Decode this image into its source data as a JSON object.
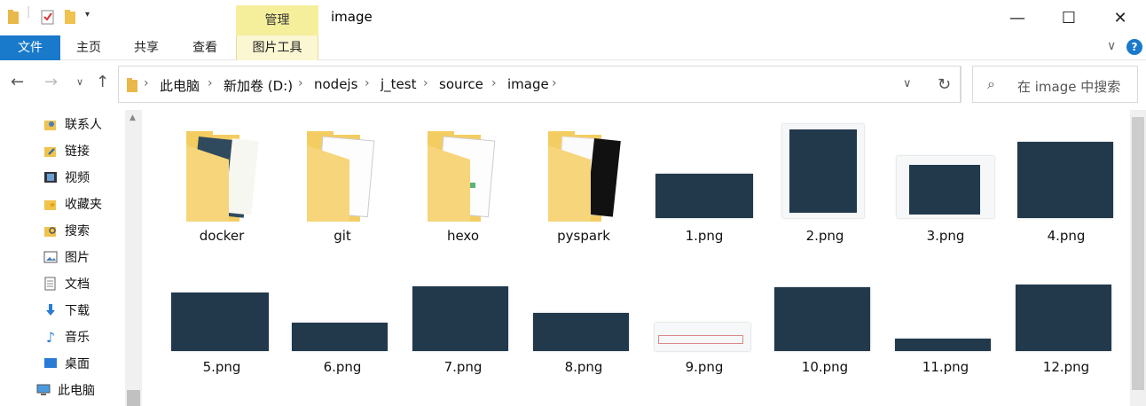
{
  "window": {
    "title": "image",
    "context_tab": "管理",
    "controls": {
      "minimize": "—",
      "maximize": "☐",
      "close": "✕"
    }
  },
  "ribbon": {
    "tabs": [
      {
        "label": "文件"
      },
      {
        "label": "主页"
      },
      {
        "label": "共享"
      },
      {
        "label": "查看"
      },
      {
        "label": "图片工具"
      }
    ],
    "help_icon": "?"
  },
  "address": {
    "root_icon": "folder-icon",
    "crumbs": [
      "此电脑",
      "新加卷 (D:)",
      "nodejs",
      "j_test",
      "source",
      "image"
    ]
  },
  "search": {
    "placeholder": "在 image 中搜索"
  },
  "sidebar": {
    "items": [
      {
        "label": "联系人",
        "icon": "contacts-icon"
      },
      {
        "label": "链接",
        "icon": "links-icon"
      },
      {
        "label": "视频",
        "icon": "videos-icon"
      },
      {
        "label": "收藏夹",
        "icon": "favorites-icon"
      },
      {
        "label": "搜索",
        "icon": "searches-icon"
      },
      {
        "label": "图片",
        "icon": "pictures-icon"
      },
      {
        "label": "文档",
        "icon": "documents-icon"
      },
      {
        "label": "下载",
        "icon": "downloads-icon"
      },
      {
        "label": "音乐",
        "icon": "music-icon"
      },
      {
        "label": "桌面",
        "icon": "desktop-icon"
      },
      {
        "label": "此电脑",
        "icon": "this-pc-icon"
      }
    ]
  },
  "files": [
    {
      "name": "docker",
      "kind": "folder"
    },
    {
      "name": "git",
      "kind": "folder"
    },
    {
      "name": "hexo",
      "kind": "folder"
    },
    {
      "name": "pyspark",
      "kind": "folder"
    },
    {
      "name": "1.png",
      "kind": "image"
    },
    {
      "name": "2.png",
      "kind": "image"
    },
    {
      "name": "3.png",
      "kind": "image"
    },
    {
      "name": "4.png",
      "kind": "image"
    },
    {
      "name": "5.png",
      "kind": "image"
    },
    {
      "name": "6.png",
      "kind": "image"
    },
    {
      "name": "7.png",
      "kind": "image"
    },
    {
      "name": "8.png",
      "kind": "image"
    },
    {
      "name": "9.png",
      "kind": "image"
    },
    {
      "name": "10.png",
      "kind": "image"
    },
    {
      "name": "11.png",
      "kind": "image"
    },
    {
      "name": "12.png",
      "kind": "image"
    }
  ],
  "colors": {
    "file_tab": "#1979ca",
    "context_tab": "#f5ef9c",
    "folder": "#f3cf6a",
    "terminal": "#22394c"
  }
}
